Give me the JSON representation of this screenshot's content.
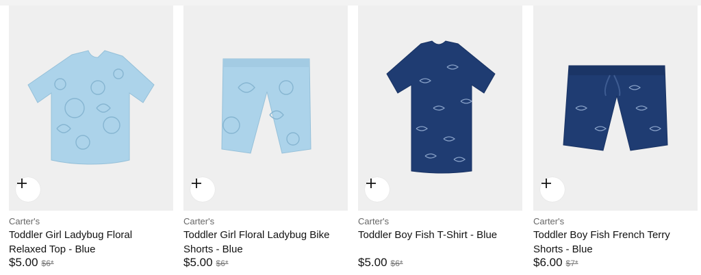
{
  "colors": {
    "light_blue": "#acd3ea",
    "navy": "#1f3c72",
    "tile_bg": "#efefef"
  },
  "products": [
    {
      "brand": "Carter's",
      "title": "Toddler Girl Ladybug Floral Relaxed Top - Blue",
      "price": "$5.00",
      "original_price": "$6*",
      "image": "light-blue-floral-tshirt",
      "add_icon": "plus-icon"
    },
    {
      "brand": "Carter's",
      "title": "Toddler Girl Floral Ladybug Bike Shorts - Blue",
      "price": "$5.00",
      "original_price": "$6*",
      "image": "light-blue-floral-bike-shorts",
      "add_icon": "plus-icon"
    },
    {
      "brand": "Carter's",
      "title": "Toddler Boy Fish T-Shirt - Blue",
      "price": "$5.00",
      "original_price": "$6*",
      "image": "navy-fish-tshirt",
      "add_icon": "plus-icon"
    },
    {
      "brand": "Carter's",
      "title": "Toddler Boy Fish French Terry Shorts - Blue",
      "price": "$6.00",
      "original_price": "$7*",
      "image": "navy-fish-shorts",
      "add_icon": "plus-icon"
    }
  ]
}
